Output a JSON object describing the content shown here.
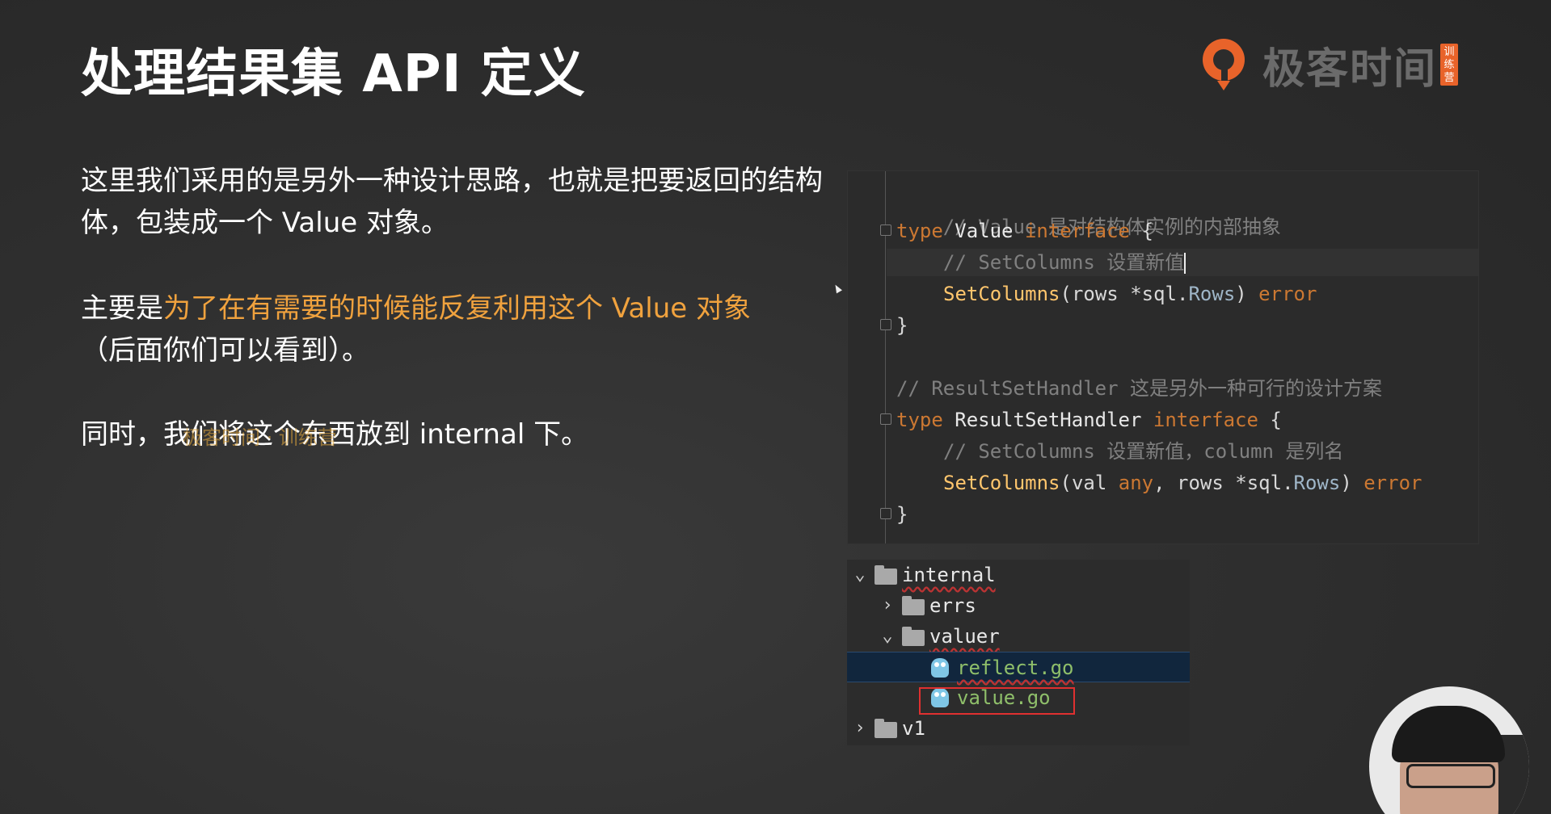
{
  "slide": {
    "title": "处理结果集 API 定义",
    "brand_name": "极客时间",
    "brand_tag": "训练营",
    "paragraph1": "这里我们采用的是另外一种设计思路，也就是把要返回的结构体，包装成一个 Value 对象。",
    "paragraph2_prefix": "主要是",
    "paragraph2_highlight": "为了在有需要的时候能反复利用这个 Value 对象",
    "paragraph2_suffix": "（后面你们可以看到）。",
    "paragraph3": "同时，我们将这个东西放到 internal 下。",
    "overlay_text": "极客时间 · 训练营",
    "highlight_color": "#f0a23e"
  },
  "code": {
    "line1": {
      "c": "// Value 是对结构体实例的内部抽象"
    },
    "line2": {
      "kw": "type",
      "name": " Value ",
      "kw2": "interface",
      "rest": " {"
    },
    "line3": {
      "c": "// SetColumns 设置新值"
    },
    "line4": {
      "fn": "SetColumns",
      "a": "(rows *",
      "pkg": "sql",
      "b": ".",
      "t": "Rows",
      "c": ") ",
      "err": "error"
    },
    "line5": "}",
    "line6": {
      "c": "// ResultSetHandler 这是另外一种可行的设计方案"
    },
    "line7": {
      "kw": "type",
      "name": " ResultSetHandler ",
      "kw2": "interface",
      "rest": " {"
    },
    "line8": {
      "c": "// SetColumns 设置新值，column 是列名"
    },
    "line9": {
      "fn": "SetColumns",
      "a": "(val ",
      "any": "any",
      "a2": ", rows *",
      "pkg": "sql",
      "b": ".",
      "t": "Rows",
      "c": ") ",
      "err": "error"
    },
    "line10": "}"
  },
  "tree": {
    "internal": "internal",
    "errs": "errs",
    "valuer": "valuer",
    "reflect": "reflect.go",
    "value": "value.go",
    "v1": "v1",
    "expanded_icon": "chevron-down-icon",
    "collapsed_icon": "chevron-right-icon"
  }
}
